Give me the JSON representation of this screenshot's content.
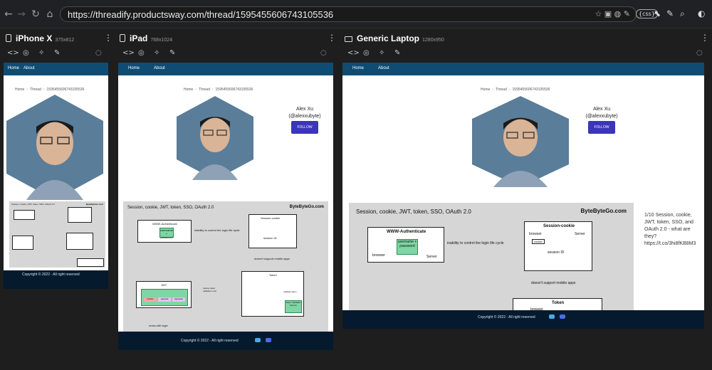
{
  "browser": {
    "url": "https://threadify.productsway.com/thread/1595455606743105536",
    "back_icon": "arrow-left-icon",
    "forward_icon": "arrow-right-icon",
    "reload_icon": "reload-icon",
    "home_icon": "home-icon",
    "extension_css_label": "{css}"
  },
  "panels": [
    {
      "name": "iPhone X",
      "dims": "375x812"
    },
    {
      "name": "iPad",
      "dims": "768x1024"
    },
    {
      "name": "Generic Laptop",
      "dims": "1280x950"
    }
  ],
  "site": {
    "nav": {
      "home": "Home",
      "about": "About"
    },
    "breadcrumb": {
      "home": "Home",
      "thread": "Thread",
      "id": "1595455606743105536"
    },
    "author": {
      "name": "Alex Xu",
      "handle": "(@alexxubyte)",
      "follow": "FOLLOW"
    },
    "footer": "Copyright © 2022 - All right reserved",
    "tweet_text": "1/10 Session, cookie, JWT, token, SSO, and OAuth 2.0 - what are they? https://t.co/3hi8fKB8M3"
  },
  "diagram": {
    "title": "Session, cookie, JWT, token, SSO, OAuth 2.0",
    "brand": "ByteByteGo.com",
    "www_auth": "WWW-Authenticate",
    "browser": "browser",
    "server": "Server",
    "username_password": "username + password",
    "inability": "inability to control the login life cycle",
    "session_cookie": "Session-cookie",
    "cookie": "cookie",
    "session_id": "session ID",
    "no_mobile": "doesn't support mobile apps",
    "token": "Token",
    "validate_token": "validate token",
    "token_validation": "Token Validation Service",
    "jwt": "JWT",
    "header": "header",
    "payload": "payload",
    "signature": "signature",
    "reduce": "reduce token validation cost",
    "cross_site": "cross-site login"
  }
}
